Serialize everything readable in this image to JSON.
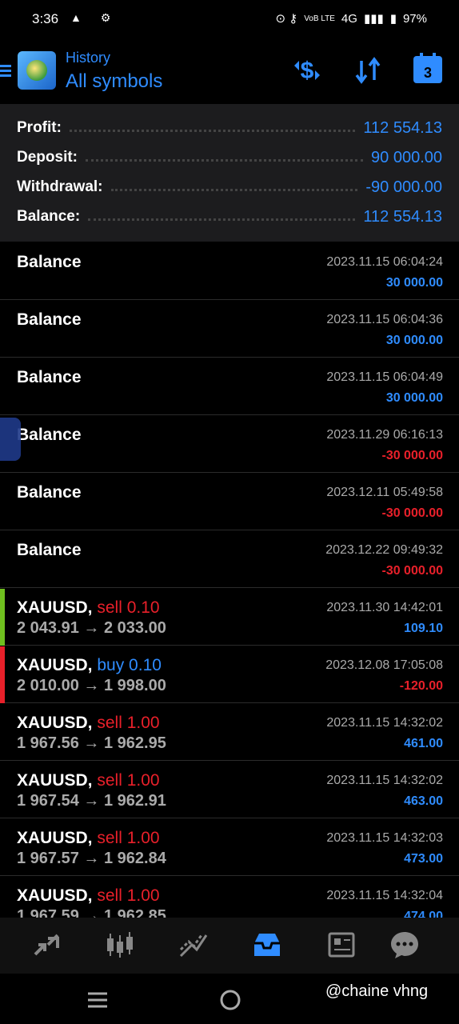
{
  "status_bar": {
    "time": "3:36",
    "left_icons": "▲ ⚙",
    "right_icons": "⊙ ⚷",
    "network_small": "VoB LTE",
    "network": "4G",
    "signal": "▮▮▮",
    "battery_icon": "▮",
    "battery": "97%"
  },
  "header": {
    "subtitle": "History",
    "title": "All symbols",
    "calendar_number": "3",
    "icons": [
      "menu-icon",
      "deposit-dollar-icon",
      "sort-icon",
      "calendar-icon"
    ]
  },
  "summary": [
    {
      "label": "Profit:",
      "value": "112 554.13"
    },
    {
      "label": "Deposit:",
      "value": "90 000.00"
    },
    {
      "label": "Withdrawal:",
      "value": "-90 000.00"
    },
    {
      "label": "Balance:",
      "value": "112 554.13"
    }
  ],
  "rows": [
    {
      "kind": "balance",
      "title": "Balance",
      "date": "2023.11.15 06:04:24",
      "amount": "30 000.00",
      "sign": "pos"
    },
    {
      "kind": "balance",
      "title": "Balance",
      "date": "2023.11.15 06:04:36",
      "amount": "30 000.00",
      "sign": "pos"
    },
    {
      "kind": "balance",
      "title": "Balance",
      "date": "2023.11.15 06:04:49",
      "amount": "30 000.00",
      "sign": "pos"
    },
    {
      "kind": "balance",
      "title": "Balance",
      "date": "2023.11.29 06:16:13",
      "amount": "-30 000.00",
      "sign": "neg"
    },
    {
      "kind": "balance",
      "title": "Balance",
      "date": "2023.12.11 05:49:58",
      "amount": "-30 000.00",
      "sign": "neg"
    },
    {
      "kind": "balance",
      "title": "Balance",
      "date": "2023.12.22 09:49:32",
      "amount": "-30 000.00",
      "sign": "neg"
    },
    {
      "kind": "trade",
      "symbol": "XAUUSD,",
      "side": "sell 0.10",
      "side_type": "sell",
      "prices": "2 043.91 → 2 033.00",
      "date": "2023.11.30 14:42:01",
      "amount": "109.10",
      "sign": "pos",
      "edge": "#6fbf1f"
    },
    {
      "kind": "trade",
      "symbol": "XAUUSD,",
      "side": "buy 0.10",
      "side_type": "buy",
      "prices": "2 010.00 → 1 998.00",
      "date": "2023.12.08 17:05:08",
      "amount": "-120.00",
      "sign": "neg",
      "edge": "#e8202a"
    },
    {
      "kind": "trade",
      "symbol": "XAUUSD,",
      "side": "sell 1.00",
      "side_type": "sell",
      "prices": "1 967.56 → 1 962.95",
      "date": "2023.11.15 14:32:02",
      "amount": "461.00",
      "sign": "pos"
    },
    {
      "kind": "trade",
      "symbol": "XAUUSD,",
      "side": "sell 1.00",
      "side_type": "sell",
      "prices": "1 967.54 → 1 962.91",
      "date": "2023.11.15 14:32:02",
      "amount": "463.00",
      "sign": "pos"
    },
    {
      "kind": "trade",
      "symbol": "XAUUSD,",
      "side": "sell 1.00",
      "side_type": "sell",
      "prices": "1 967.57 → 1 962.84",
      "date": "2023.11.15 14:32:03",
      "amount": "473.00",
      "sign": "pos"
    },
    {
      "kind": "trade",
      "symbol": "XAUUSD,",
      "side": "sell 1.00",
      "side_type": "sell",
      "prices": "1 967.59 → 1 962.85",
      "date": "2023.11.15 14:32:04",
      "amount": "474.00",
      "sign": "pos"
    }
  ],
  "bottom_nav": [
    {
      "name": "quotes-icon",
      "glyph": "⇅",
      "active": false
    },
    {
      "name": "chart-icon",
      "glyph": "⫼",
      "active": false
    },
    {
      "name": "trade-icon",
      "glyph": "⤢",
      "active": false
    },
    {
      "name": "history-icon",
      "glyph": "⬓",
      "active": true
    },
    {
      "name": "news-icon",
      "glyph": "▤",
      "active": false
    },
    {
      "name": "messages-icon",
      "glyph": "●",
      "active": false
    }
  ],
  "watermark": "@chaine vhng",
  "colors": {
    "accent": "#2f8cff",
    "loss": "#e8202a",
    "profit_edge": "#6fbf1f"
  }
}
